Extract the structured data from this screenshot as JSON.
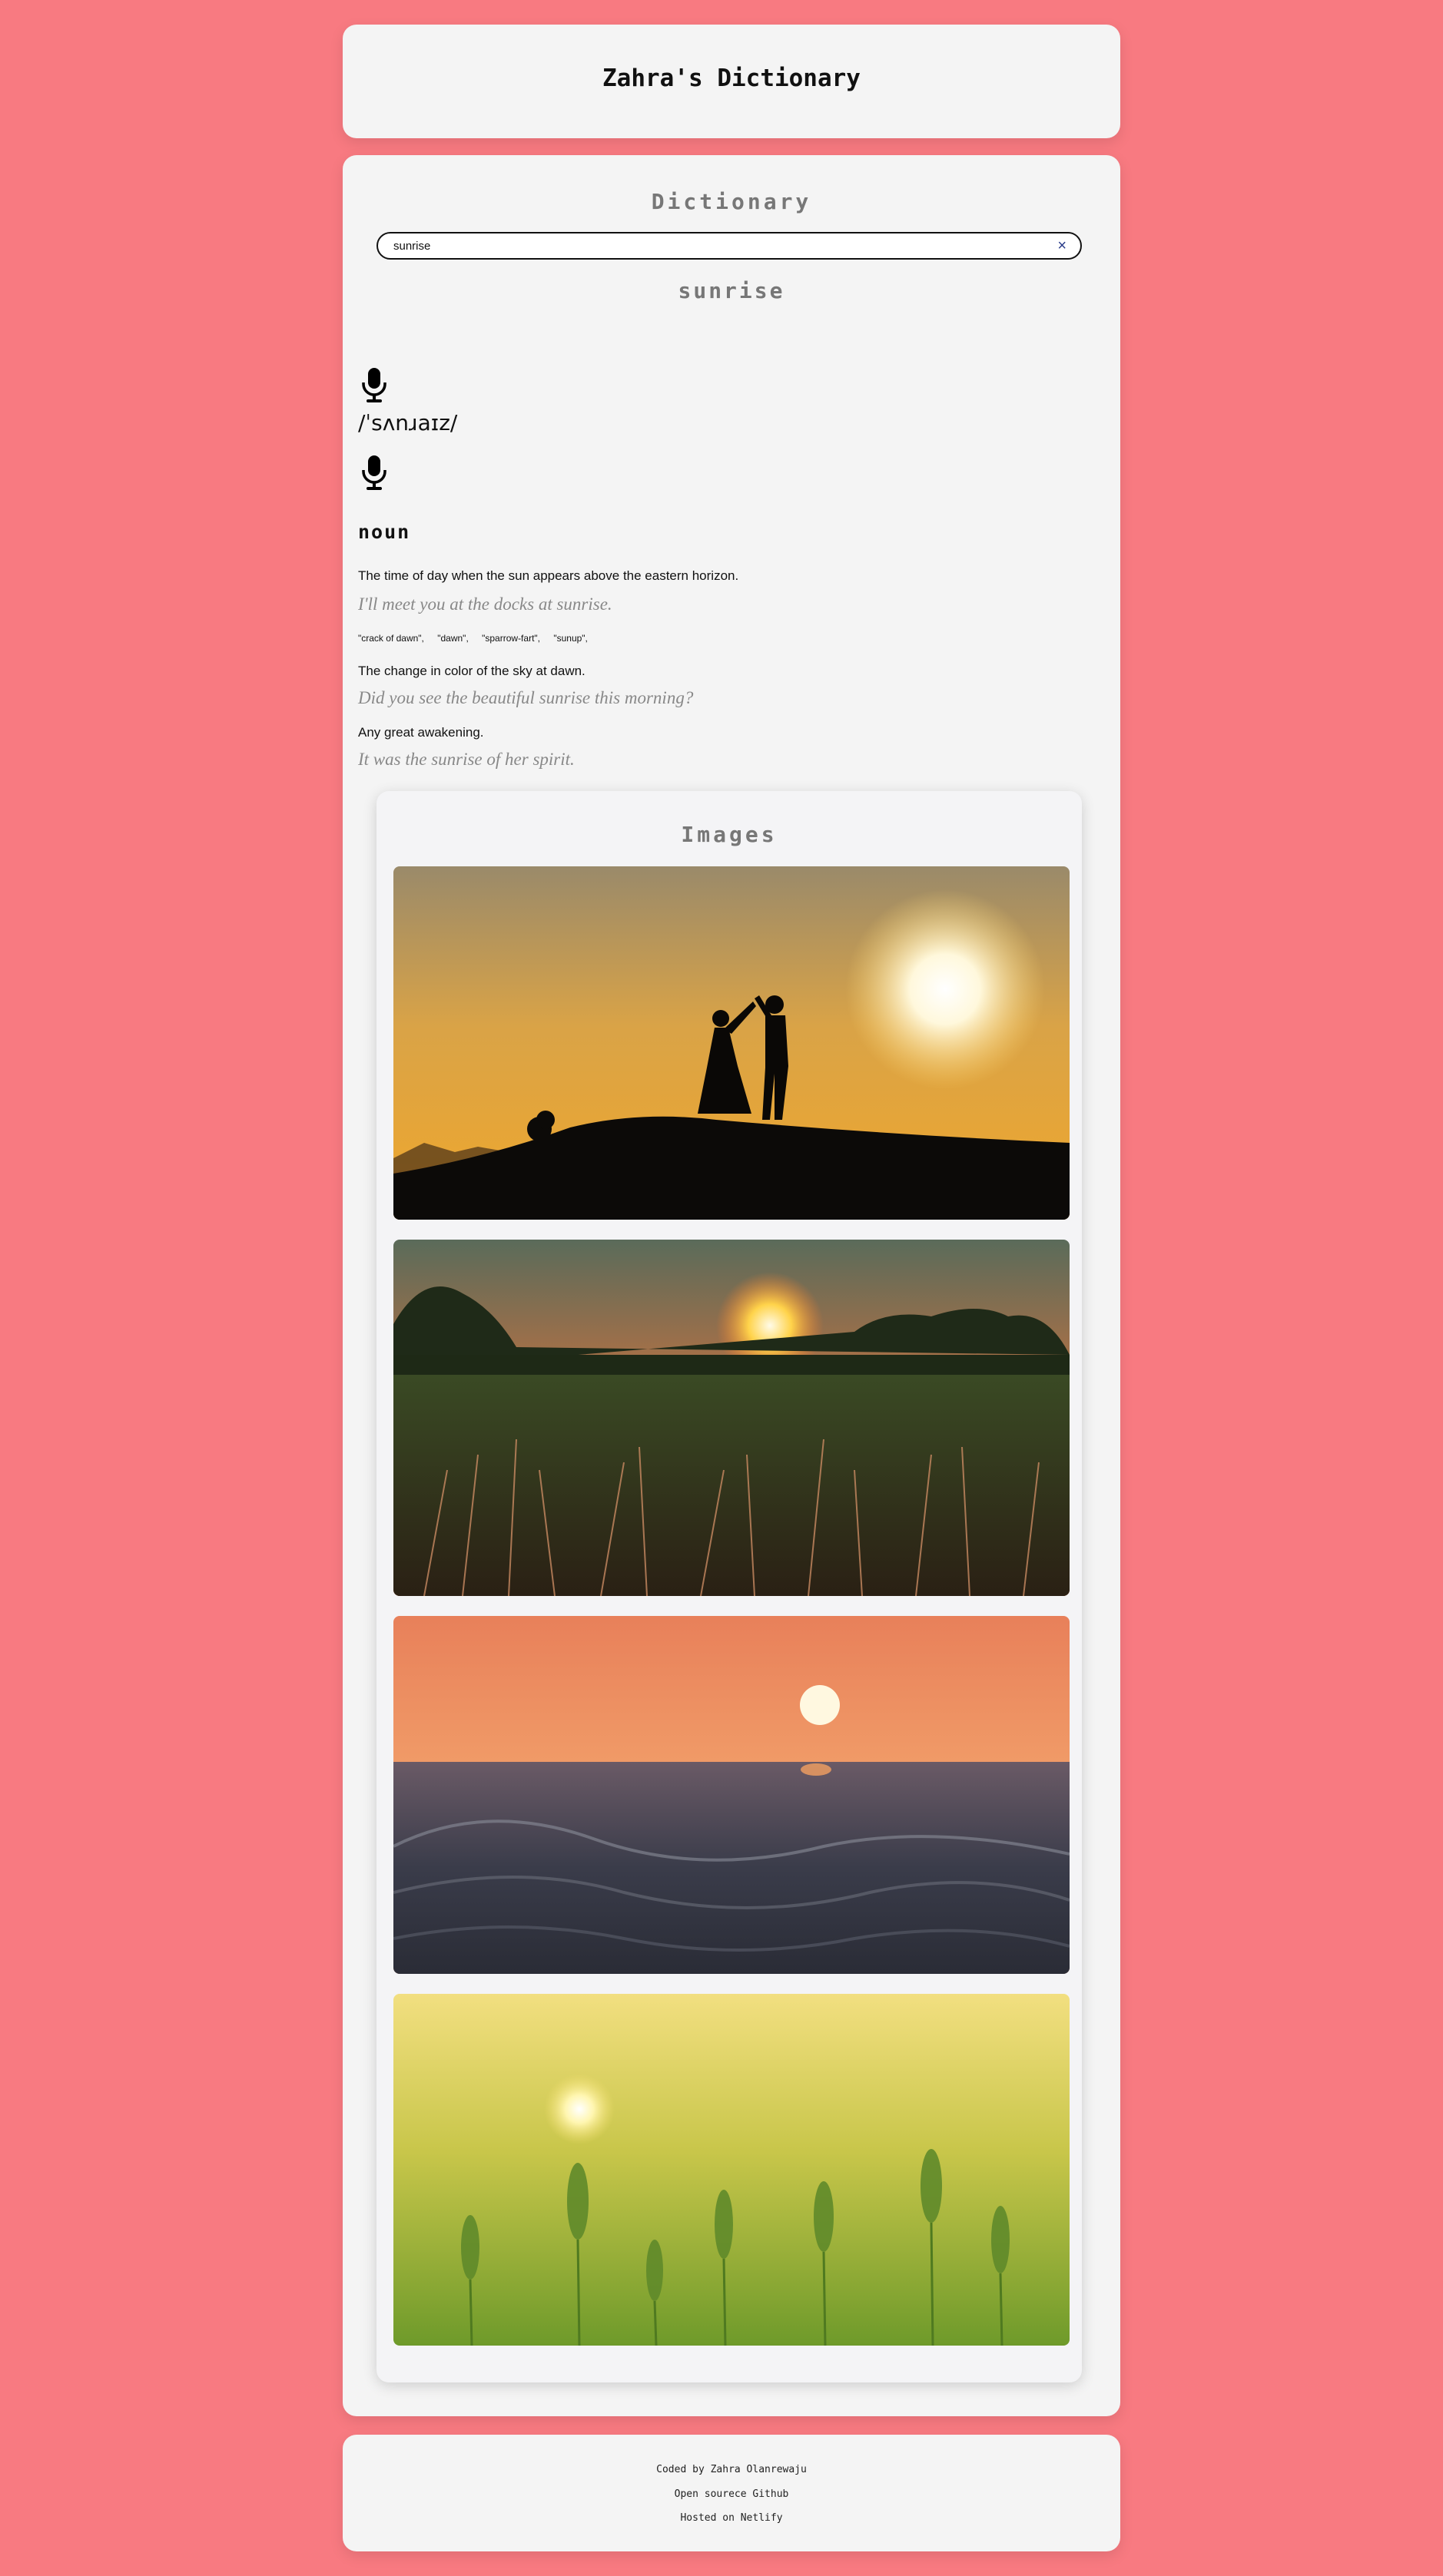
{
  "header": {
    "title": "Zahra's Dictionary"
  },
  "dictionary": {
    "section_title": "Dictionary",
    "search": {
      "value": "sunrise",
      "placeholder": "",
      "clear_label": "×"
    },
    "word": "sunrise",
    "phonetic": "/ˈsʌnɹaɪz/",
    "icons": [
      "microphone-icon",
      "microphone-icon"
    ],
    "meaning": {
      "part_of_speech": "noun",
      "definitions": [
        {
          "definition": "The time of day when the sun appears above the eastern horizon.",
          "example": "I'll meet you at the docks at sunrise."
        },
        {
          "definition": "The change in color of the sky at dawn.",
          "example": "Did you see the beautiful sunrise this morning?"
        },
        {
          "definition": "Any great awakening.",
          "example": "It was the sunrise of her spirit."
        }
      ],
      "synonyms": [
        "\"crack of dawn\",",
        "\"dawn\",",
        "\"sparrow-fart\",",
        "\"sunup\","
      ]
    }
  },
  "images": {
    "title": "Images",
    "photos": [
      "couple-silhouette-sunset-photo",
      "sunrise-over-grass-field-photo",
      "sunrise-over-ocean-waves-photo",
      "sun-through-wheat-field-photo"
    ]
  },
  "footer": {
    "coded_by": "Coded by Zahra Olanrewaju",
    "github": "Open sourece Github",
    "hosting": "Hosted on Netlify"
  },
  "colors": {
    "page_background": "#f87a81",
    "card_background": "#f4f4f4",
    "heading_gray": "#777777",
    "clear_icon": "#2a3c8a"
  }
}
